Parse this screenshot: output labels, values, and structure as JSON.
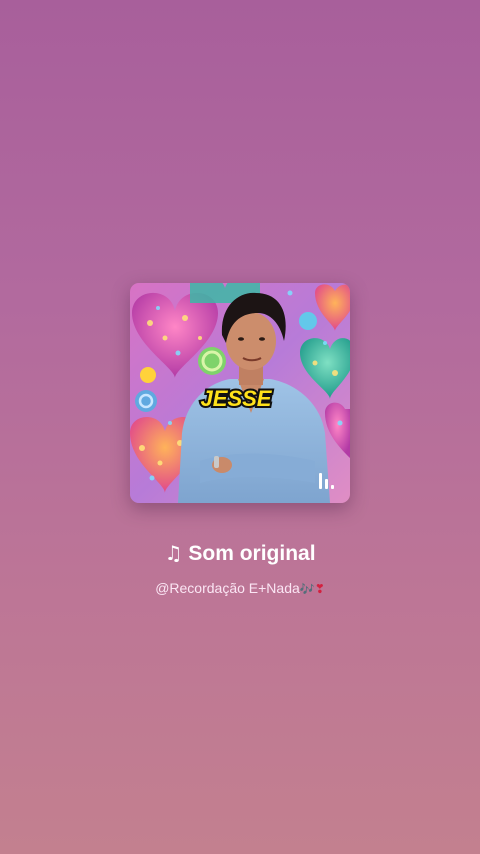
{
  "sound": {
    "title": "Som original",
    "author": "@Recordação E+Nada",
    "author_emoji_1": "🎶",
    "author_emoji_2": "❣"
  },
  "cover": {
    "badge_text": "JESSE",
    "icon": "audio-bars-icon",
    "colors": {
      "badge_fill": "#ffe21a",
      "badge_stroke": "#111111",
      "shirt": "#8fb6dc",
      "background_accent": "#d873c4"
    }
  },
  "colors": {
    "background_top": "#a85f9b",
    "background_bottom": "#c3808f",
    "title": "#ffffff",
    "subtitle": "#fbe6f4"
  }
}
